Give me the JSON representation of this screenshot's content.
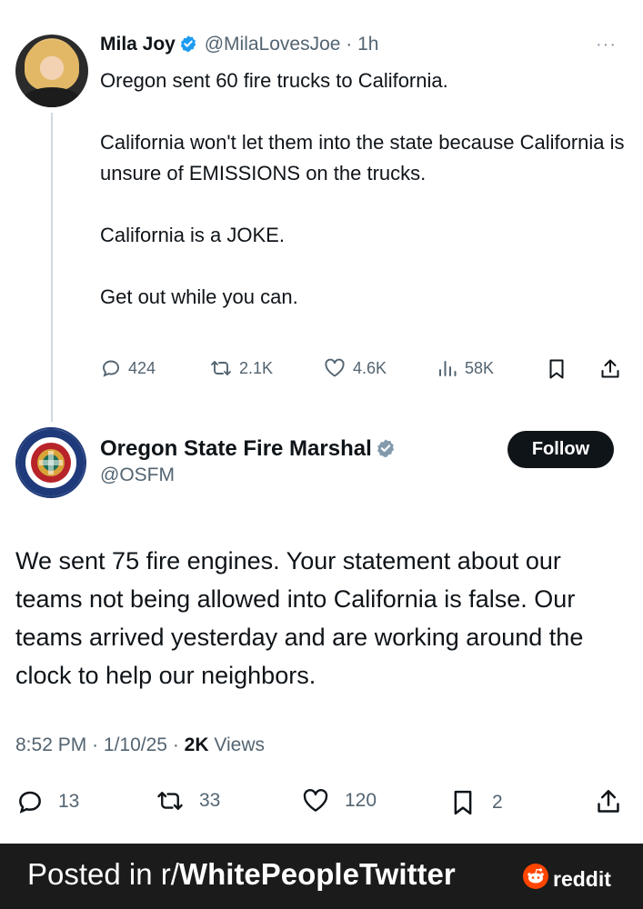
{
  "tweet1": {
    "name": "Mila Joy",
    "handle": "@MilaLovesJoe",
    "separator": "·",
    "time": "1h",
    "more": "···",
    "body": [
      "Oregon sent 60 fire trucks to California.",
      "California won't let them into the state because California is unsure of EMISSIONS on the trucks.",
      "California is a JOKE.",
      "Get out while you can."
    ],
    "stats": {
      "replies": "424",
      "reposts": "2.1K",
      "likes": "4.6K",
      "views": "58K"
    }
  },
  "tweet2": {
    "name": "Oregon State Fire Marshal",
    "handle": "@OSFM",
    "follow_label": "Follow",
    "body": "We sent 75 fire engines. Your statement about our teams not being allowed into California is false. Our teams arrived yesterday and are working around the clock to help our neighbors.",
    "time": "8:52 PM",
    "date": "1/10/25",
    "sep": "·",
    "views_count": "2K",
    "views_label": "Views",
    "stats": {
      "replies": "13",
      "reposts": "33",
      "likes": "120",
      "bookmarks": "2"
    }
  },
  "footer": {
    "prefix": "Posted in r/",
    "subreddit": "WhitePeopleTwitter",
    "brand": "reddit"
  },
  "colors": {
    "text": "#0f1419",
    "muted": "#536471",
    "verified_blue": "#1d9bf0",
    "verified_gray": "#829aab",
    "footer_bg": "#1b1b1b",
    "reddit_orange": "#ff4500"
  }
}
